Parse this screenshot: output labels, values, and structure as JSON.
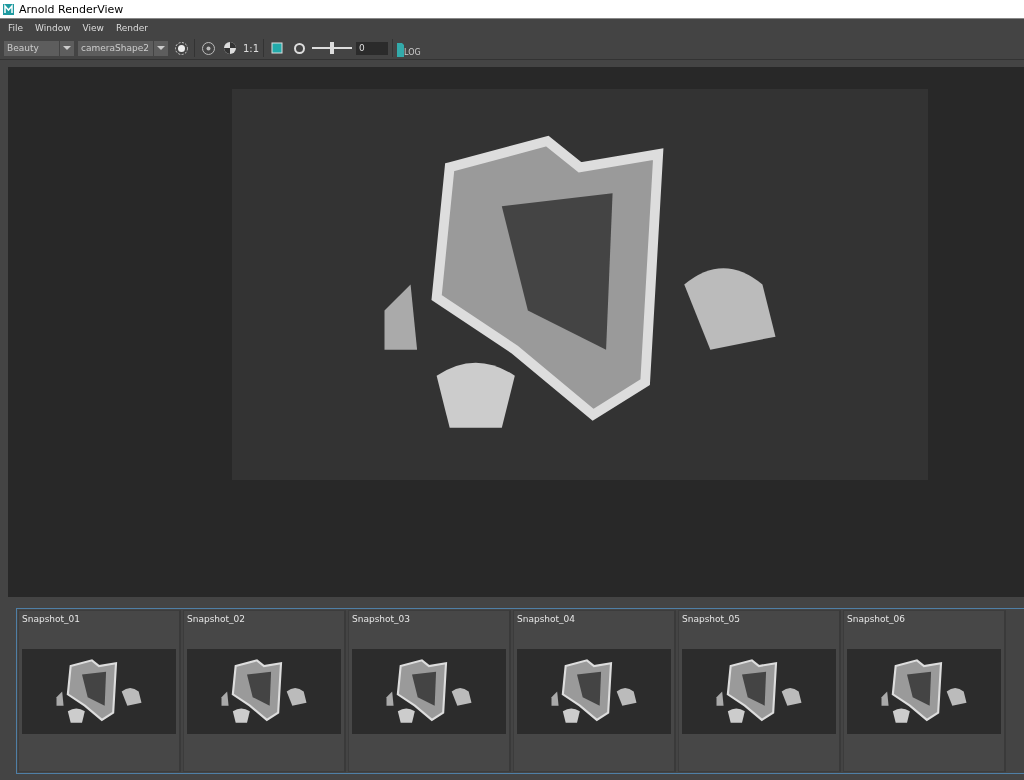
{
  "window": {
    "title": "Arnold RenderView"
  },
  "menu": [
    "File",
    "Window",
    "View",
    "Render"
  ],
  "toolbar": {
    "aov": "Beauty",
    "camera": "cameraShape2",
    "ratio": "1:1",
    "exposure": {
      "level": 0.5,
      "value": "0"
    },
    "log": "LOG"
  },
  "snapshots": [
    {
      "label": "Snapshot_01"
    },
    {
      "label": "Snapshot_02"
    },
    {
      "label": "Snapshot_03"
    },
    {
      "label": "Snapshot_04"
    },
    {
      "label": "Snapshot_05"
    },
    {
      "label": "Snapshot_06"
    }
  ]
}
